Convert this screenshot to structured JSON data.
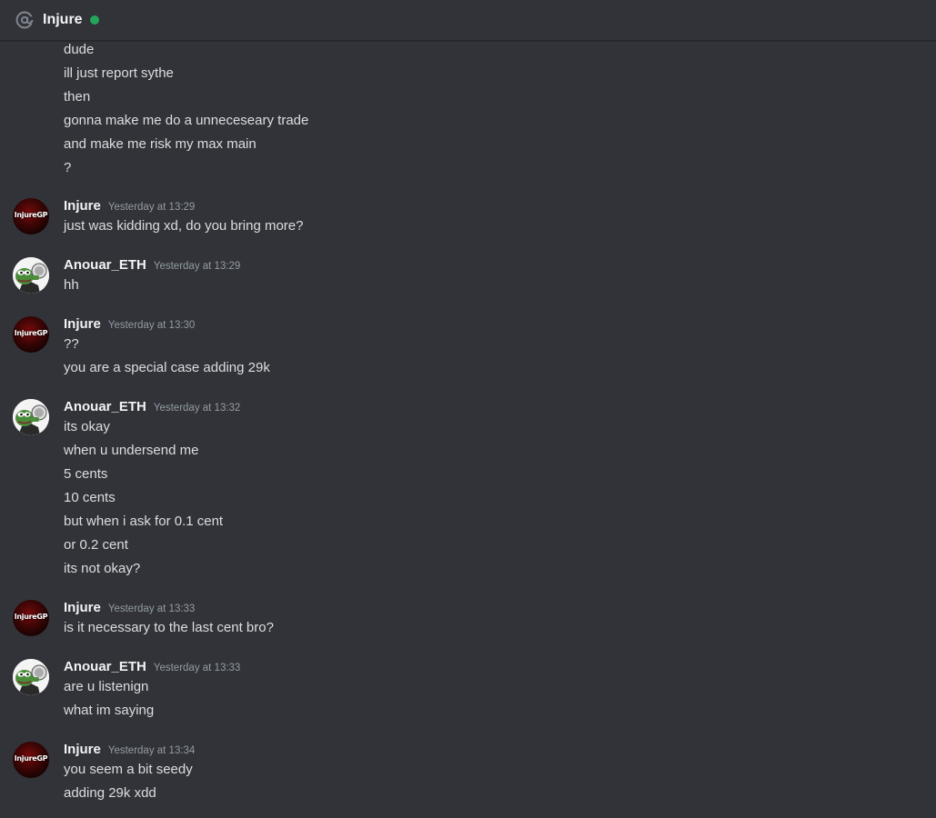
{
  "header": {
    "title": "Injure",
    "icon": "at-sign-icon",
    "status_color": "#23a55a"
  },
  "avatars": {
    "injure_text": "InjureGP"
  },
  "continuation": [
    "dude",
    "ill just report sythe",
    "then",
    "gonna make me do a unneceseary trade",
    "and make me risk my max main",
    "?"
  ],
  "groups": [
    {
      "author": "Injure",
      "time": "Yesterday at 13:29",
      "lines": [
        "just was kidding xd, do you bring more?"
      ]
    },
    {
      "author": "Anouar_ETH",
      "time": "Yesterday at 13:29",
      "lines": [
        "hh"
      ]
    },
    {
      "author": "Injure",
      "time": "Yesterday at 13:30",
      "lines": [
        "??",
        "you are a special case adding 29k"
      ]
    },
    {
      "author": "Anouar_ETH",
      "time": "Yesterday at 13:32",
      "lines": [
        "its okay",
        "when u undersend me",
        "5 cents",
        "10 cents",
        "but when i ask for 0.1 cent",
        "or 0.2 cent",
        "its not okay?"
      ]
    },
    {
      "author": "Injure",
      "time": "Yesterday at 13:33",
      "lines": [
        "is it necessary to the last cent bro?"
      ]
    },
    {
      "author": "Anouar_ETH",
      "time": "Yesterday at 13:33",
      "lines": [
        "are u listenign",
        "what im saying"
      ]
    },
    {
      "author": "Injure",
      "time": "Yesterday at 13:34",
      "lines": [
        "you seem a bit seedy",
        "adding 29k xdd"
      ]
    }
  ]
}
